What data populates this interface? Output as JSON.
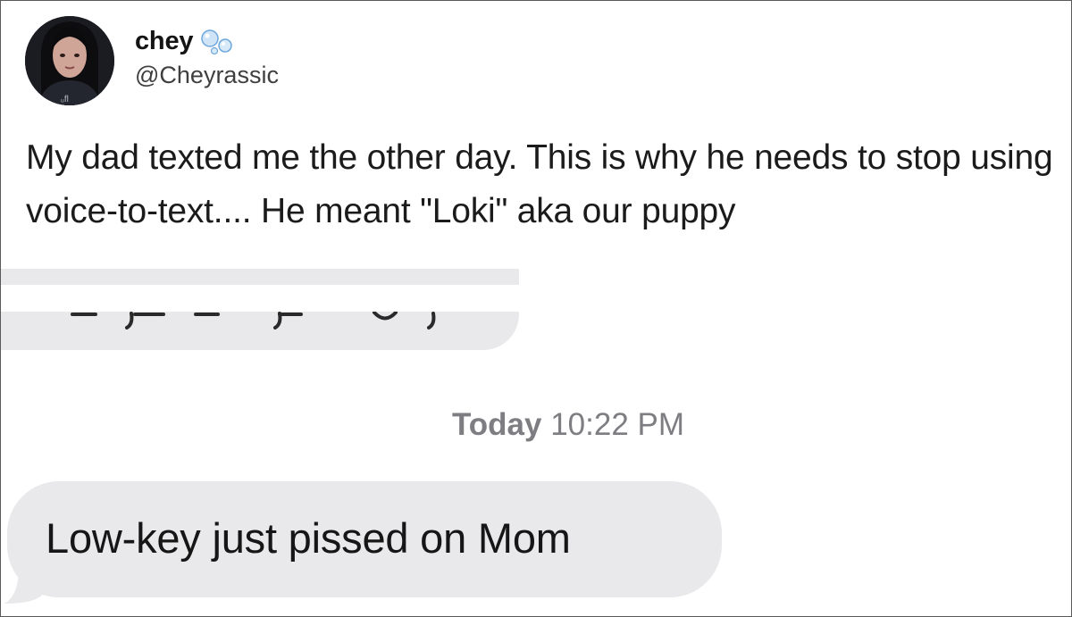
{
  "tweet": {
    "author": {
      "display_name": "chey",
      "handle": "@Cheyrassic",
      "avatar_icon": "profile-photo",
      "name_decoration_icon": "bubbles-icon"
    },
    "text": "My dad texted me the other day. This is why he needs to stop using voice-to-text.... He meant \"Loki\" aka our puppy"
  },
  "messages": {
    "timestamp_day": "Today",
    "timestamp_time": "10:22 PM",
    "incoming_message": "Low-key just pissed on Mom",
    "bubble_color": "#e9e9eb",
    "timestamp_color": "#7d7d82"
  }
}
